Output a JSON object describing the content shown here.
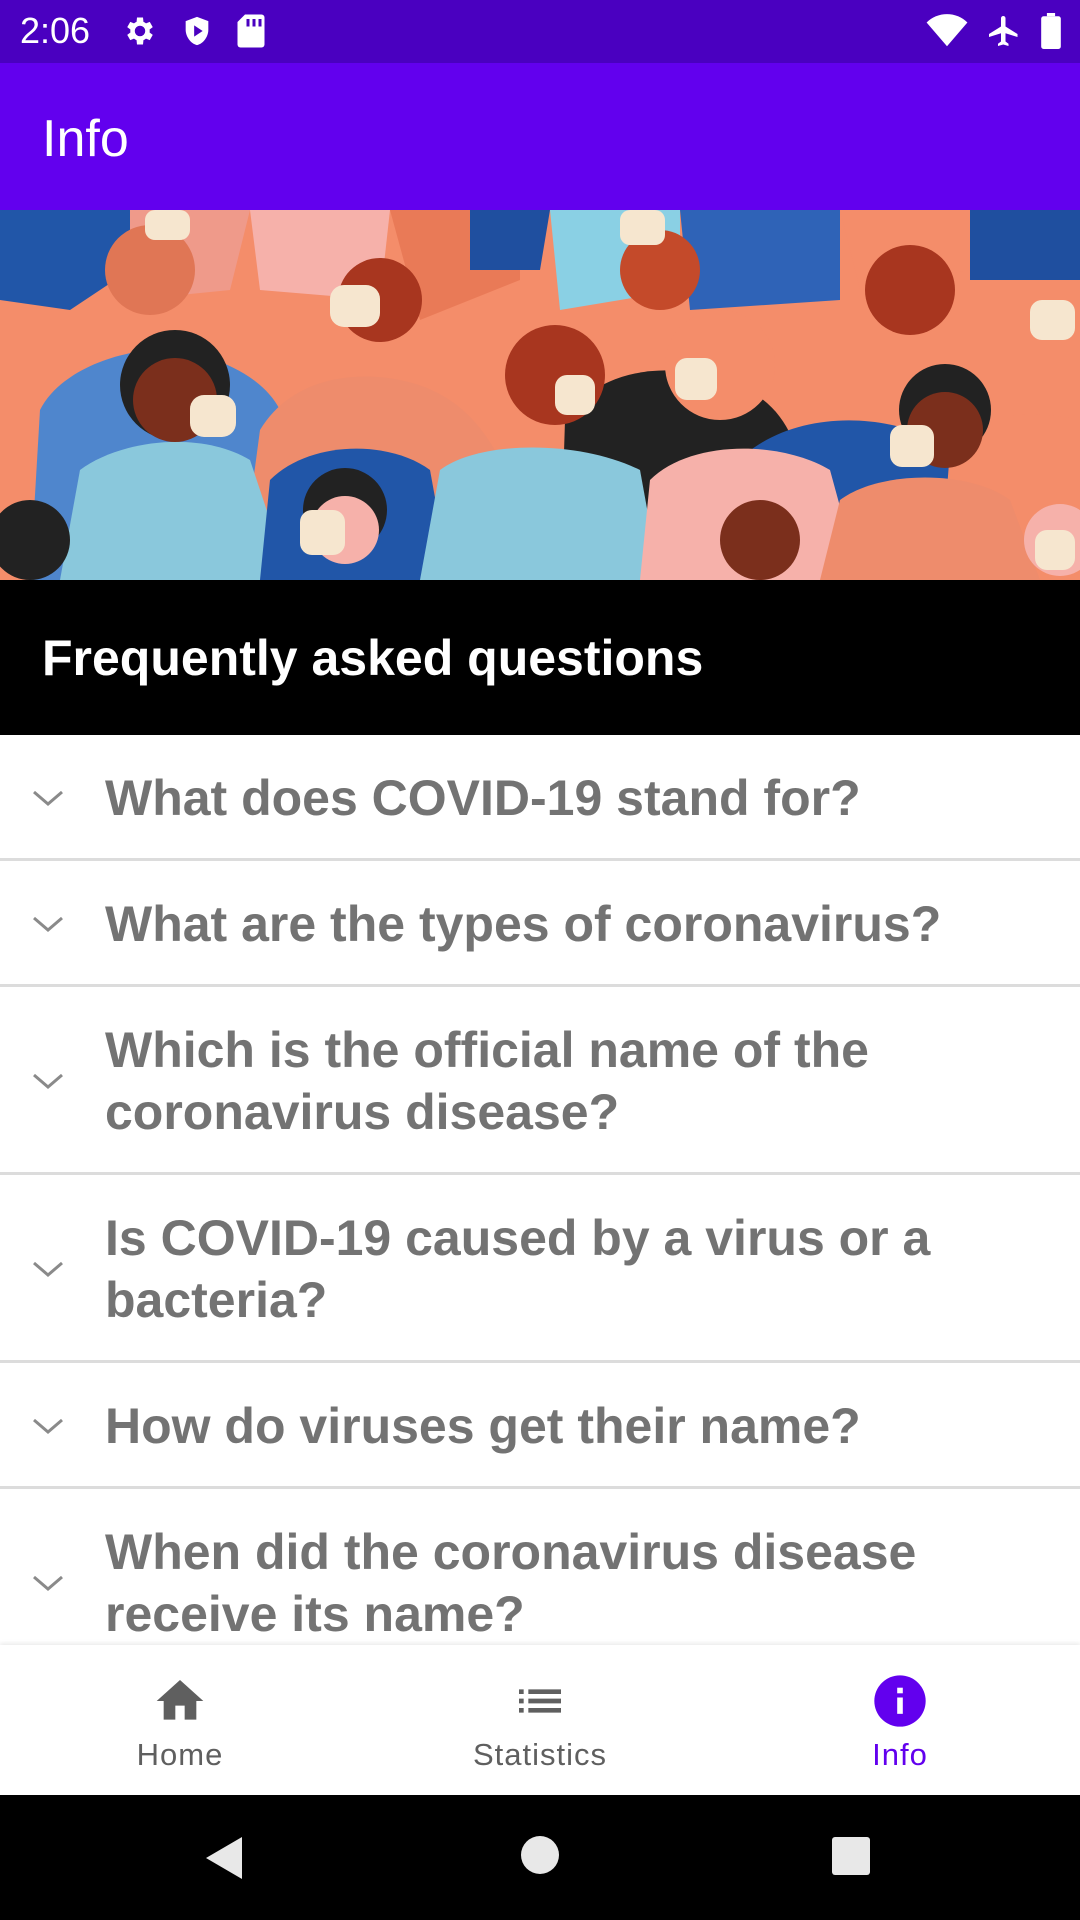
{
  "status_bar": {
    "time": "2:06",
    "left_icons": [
      "gear-icon",
      "shield-play-icon",
      "sd-card-icon"
    ],
    "right_icons": [
      "wifi-icon",
      "airplane-icon",
      "battery-icon"
    ]
  },
  "app_bar": {
    "title": "Info"
  },
  "hero": {
    "image": "crowd-wearing-masks-illustration"
  },
  "faq": {
    "title": "Frequently asked questions",
    "items": [
      {
        "question": "What does COVID-19 stand for?"
      },
      {
        "question": "What are the types of coronavirus?"
      },
      {
        "question": "Which is the official name of the coronavirus disease?"
      },
      {
        "question": "Is COVID-19 caused by a virus or a bacteria?"
      },
      {
        "question": "How do viruses get their name?"
      },
      {
        "question": "When did the coronavirus disease receive its name?"
      }
    ]
  },
  "bottom_nav": {
    "items": [
      {
        "label": "Home",
        "icon": "home-icon",
        "active": false
      },
      {
        "label": "Statistics",
        "icon": "list-icon",
        "active": false
      },
      {
        "label": "Info",
        "icon": "info-icon",
        "active": true
      }
    ]
  },
  "colors": {
    "status_bar": "#4a00c0",
    "app_bar": "#6200ee",
    "active_nav": "#6200ee",
    "inactive_nav": "#5f5f5f",
    "question_text": "#737373"
  }
}
